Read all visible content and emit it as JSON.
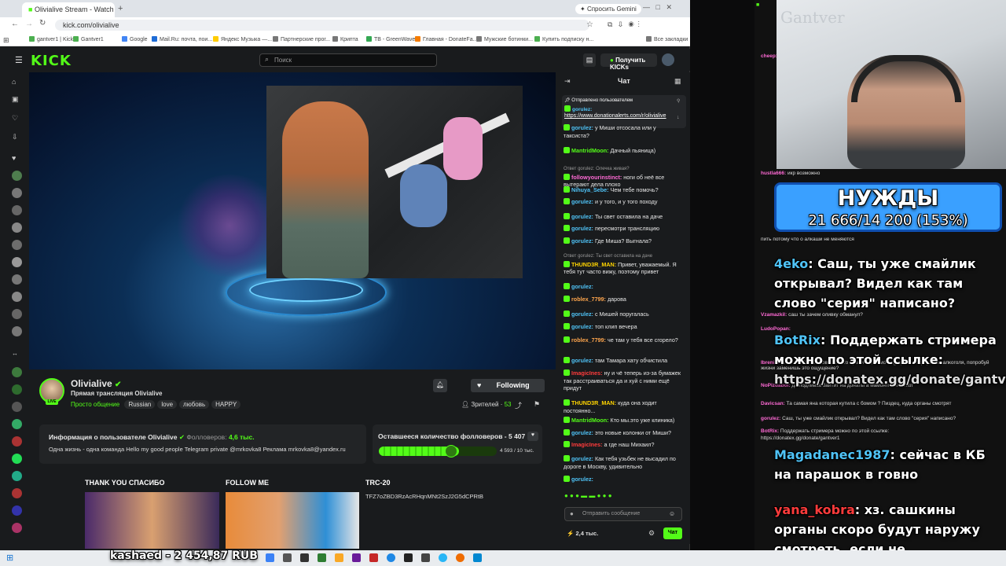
{
  "browser": {
    "tabs": [
      "Olivialive Stream - Watch L",
      "Спросить Gemini"
    ],
    "url": "kick.com/olivialive",
    "bookmarks": [
      "gantver1 | Kick",
      "Gantver1",
      "Google",
      "Mail.Ru: почта, пои...",
      "Яндекс Музыка —...",
      "Партнерские прог...",
      "Крипта",
      "TB - GreenWave",
      "Главная - DonateFa...",
      "Мужские ботинки...",
      "Купить подписку н...",
      "Все закладки"
    ]
  },
  "kick": {
    "logo": "KICK",
    "search_placeholder": "Поиск",
    "get_kicks": "Получить KICKs",
    "chat_title": "Чат"
  },
  "streamer": {
    "name": "Olivialive",
    "title": "Прямая трансляция Olivialive",
    "category": "Просто общение",
    "tags": [
      "Russian",
      "love",
      "любовь",
      "HAPPY"
    ],
    "follow_label": "Following",
    "viewers_label": "Зрителей",
    "viewers": "53"
  },
  "info": {
    "heading": "Информация о пользователе Olivialive",
    "followers_label": "Фолловеров:",
    "followers": "4,6 тыс.",
    "bio": "Одна жизнь - одна команда Hello my good people  Telegram private @mrkovka8 Реклама mrkovka8@yandex.ru"
  },
  "goal": {
    "title": "Оставшееся количество фолловеров - 5 407 !",
    "progress_text": "4 593 / 10 тыс.",
    "progress_fraction": 0.459
  },
  "panels": [
    {
      "title": "THANK YOU СПАСИБО"
    },
    {
      "title": "FOLLOW ME"
    },
    {
      "title": "TRC-20",
      "text": "TFZ7oZBD3RzAcRHqnMNt2SzJ2G5dCPRtB"
    }
  ],
  "chat": {
    "pinned_label": "Отправлено пользователем",
    "pinned_user": "gorulez:",
    "pinned_link": "https://www.donationalerts.com/r/olivialive",
    "messages": [
      {
        "user": "gorulez:",
        "text": "у Миши отсосала или у таксиста?",
        "color": "cyan"
      },
      {
        "user": "MantridMoon:",
        "text": "Дачный пьяница)",
        "color": "green"
      },
      {
        "reply": "Ответ gorulez: Олечка живая?",
        "user": "followyourinstinct:",
        "text": "ноги об неё все вытерают дела плохо",
        "color": "pink"
      },
      {
        "user": "Nihuya_Sebe:",
        "text": "Чем тебе помочь?",
        "color": "cyan"
      },
      {
        "user": "gorulez:",
        "text": "и у того, и у того походу",
        "color": "cyan"
      },
      {
        "user": "gorulez:",
        "text": "Ты свет оставила на даче",
        "color": "cyan"
      },
      {
        "user": "gorulez:",
        "text": "пересмотри трансляцию",
        "color": "cyan"
      },
      {
        "user": "gorulez:",
        "text": "Где Миша? Выгнала?",
        "color": "cyan"
      },
      {
        "reply": "Ответ gorulez: Ты свет оставила на даче",
        "user": "THUND3R_MAN:",
        "text": "Привет, уважаемый. Я тебя тут часто вижу, поэтому привет",
        "color": "yellow"
      },
      {
        "user": "gorulez:",
        "text": "",
        "color": "cyan"
      },
      {
        "user": "roblex_7799:",
        "text": "дарова",
        "color": "orange"
      },
      {
        "user": "gorulez:",
        "text": "с Мишей поругалась",
        "color": "cyan"
      },
      {
        "user": "gorulez:",
        "text": "топ клип вечера",
        "color": "cyan"
      },
      {
        "user": "roblex_7799:",
        "text": "че там у тебя все сгорело?",
        "color": "orange"
      },
      {
        "user": "gorulez:",
        "text": "там Тамара хату обчистила",
        "color": "cyan"
      },
      {
        "user": "ImagicInes:",
        "text": "ну и чё теперь из-за бумажек так расстраиваться да и хуй с ними ещё придут",
        "color": "red"
      },
      {
        "user": "THUND3R_MAN:",
        "text": "куда она ходит постоянно...",
        "color": "yellow"
      },
      {
        "user": "MantridMoon:",
        "text": "Кто мы.это уже клиника)",
        "color": "green"
      },
      {
        "user": "gorulez:",
        "text": "это новые колонки от Миши?",
        "color": "cyan"
      },
      {
        "user": "ImagicInes:",
        "text": "а где наш Михаил?",
        "color": "red"
      },
      {
        "user": "gorulez:",
        "text": "Как тебя узьбек не высадил по дороге в Москву, удивительно",
        "color": "cyan"
      },
      {
        "user": "gorulez:",
        "text": "",
        "color": "cyan"
      }
    ],
    "input_placeholder": "Отправить сообщение",
    "viewer_count": "2,4 тыс.",
    "send_label": "Чат"
  },
  "overlay": {
    "goal_title": "НУЖДЫ",
    "goal_value": "21 666/14 200 (153%)",
    "alert1_user": "4eko",
    "alert1_text": ": Саш, ты уже смайлик открывал? Видел как там слово \"серия\" написано?",
    "alert2_user": "BotRix",
    "alert2_text": ": Поддержать стримера можно по этой ссылке:",
    "alert2_link": "https://donatex.gg/donate/gantver1",
    "alert3_user": "Magadanec1987",
    "alert3_text": ": сейчас в КБ на парашок в говно",
    "alert4_user": "yana_kobra",
    "alert4_text": ": хз. сашкины органы скоро будут наружу смотреть, если не закодируется",
    "donation_ticker": "kashaed - 2 454,87 RUB",
    "right_chat": [
      {
        "user": "cheep:",
        "text": ""
      },
      {
        "user": "hustla666:",
        "text": "икр возможно"
      },
      {
        "user": "",
        "text": "пить потому что о алкаши не меняются"
      },
      {
        "user": "Vzamazkil:",
        "text": "саш ты зачем оливку обманул?"
      },
      {
        "user": "LudoPopan:",
        "text": ""
      },
      {
        "user": "Ibrenix:",
        "text": "gantver1 Ты сам говорил что нравится, само ощущения эйфории от алкоголя, попробуй жизни заменишь это ощущение?"
      },
      {
        "user": "NoPizdabol:",
        "text": "да подливка байтит на донаты а мамонты не шлют"
      },
      {
        "user": "Davicsan:",
        "text": "Та самая яна которая кутила с бомом ? Пиздец, куда органы смотрят"
      },
      {
        "user": "gorulez:",
        "text": "Саш, ты уже смайлик открывал? Видел как там слово \"серия\" написано?"
      },
      {
        "user": "BotRix:",
        "text": "Поддержать стримера можно по этой ссылке:"
      },
      {
        "user": "",
        "text": "https://donatex.gg/donate/gantver1"
      }
    ]
  }
}
